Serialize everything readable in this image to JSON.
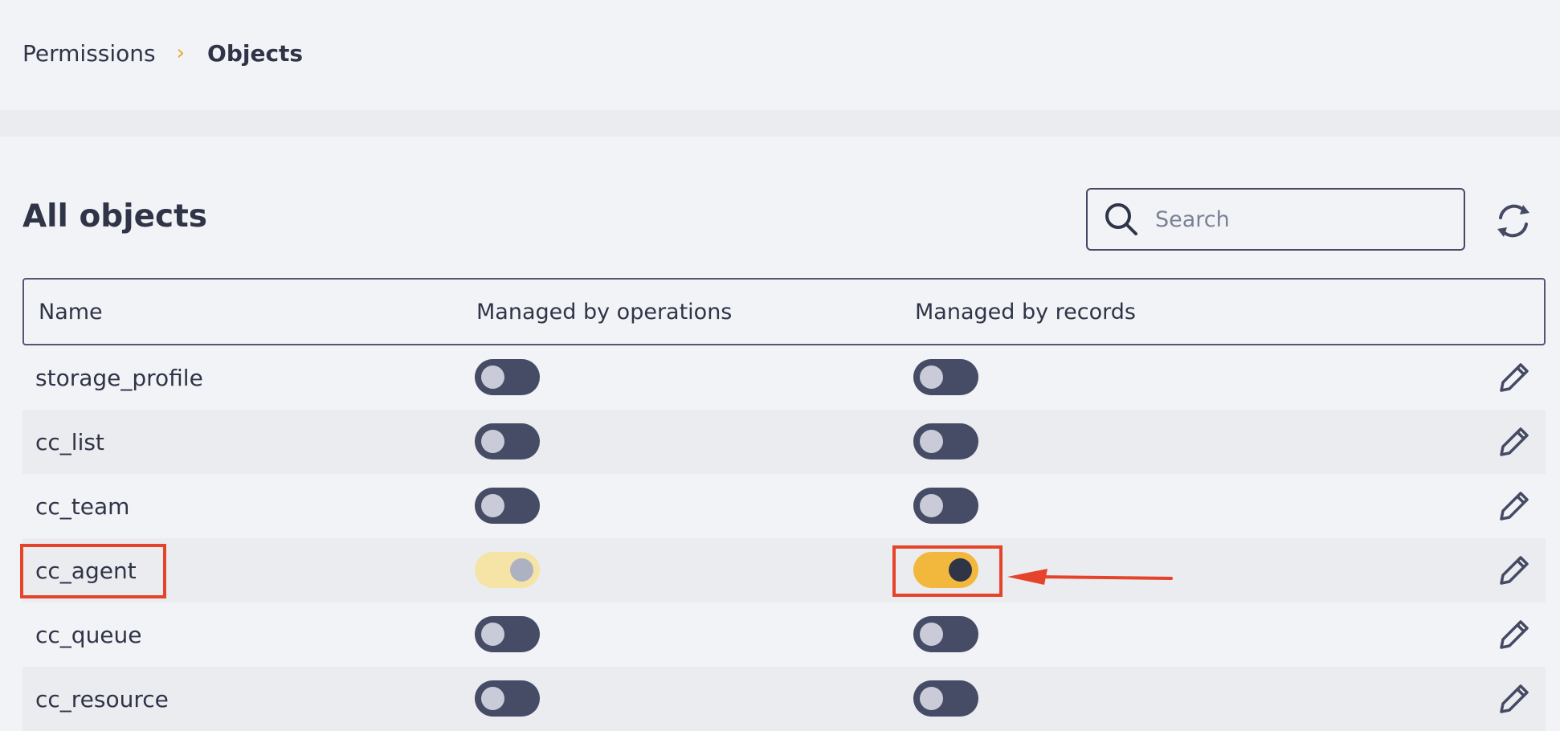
{
  "breadcrumb": {
    "parent": "Permissions",
    "separator": "›",
    "current": "Objects"
  },
  "section": {
    "title": "All objects"
  },
  "search": {
    "placeholder": "Search",
    "value": ""
  },
  "table": {
    "columns": [
      "Name",
      "Managed by operations",
      "Managed by records"
    ],
    "rows": [
      {
        "name": "storage_profile",
        "managed_by_operations": false,
        "managed_by_records": false
      },
      {
        "name": "cc_list",
        "managed_by_operations": false,
        "managed_by_records": false
      },
      {
        "name": "cc_team",
        "managed_by_operations": false,
        "managed_by_records": false
      },
      {
        "name": "cc_agent",
        "managed_by_operations": "on-disabled",
        "managed_by_records": true,
        "highlighted": true
      },
      {
        "name": "cc_queue",
        "managed_by_operations": false,
        "managed_by_records": false
      },
      {
        "name": "cc_resource",
        "managed_by_operations": false,
        "managed_by_records": false
      }
    ]
  },
  "icons": {
    "search": "search-icon",
    "refresh": "refresh-icon",
    "edit": "pencil-icon",
    "annotation_arrow": "arrow-left-icon"
  },
  "colors": {
    "accent": "#f2b83d",
    "toggle_off": "#464c66",
    "annotation": "#e5432a",
    "text": "#2f3447"
  }
}
